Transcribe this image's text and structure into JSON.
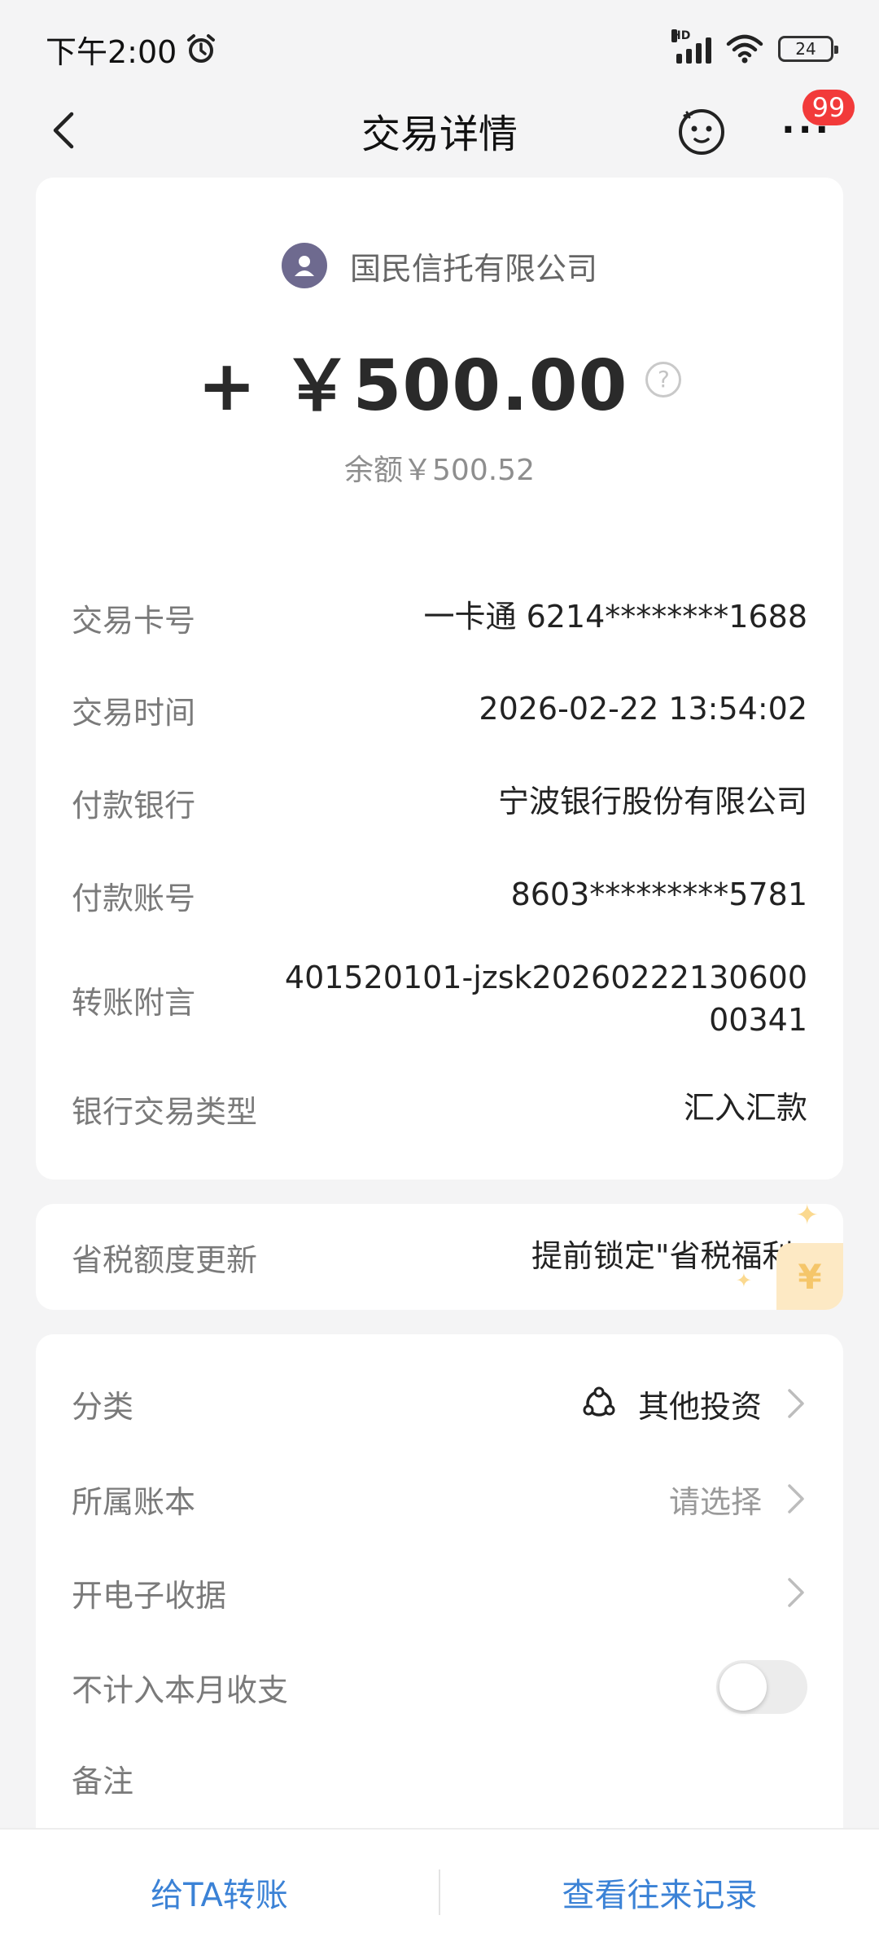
{
  "status_bar": {
    "time": "下午2:00",
    "network_label": "HD",
    "battery": "24"
  },
  "nav": {
    "title": "交易详情",
    "badge": "99"
  },
  "transaction": {
    "merchant": "国民信托有限公司",
    "amount": "+ ￥500.00",
    "balance": "余额￥500.52",
    "details": [
      {
        "label": "交易卡号",
        "value": "一卡通 6214********1688"
      },
      {
        "label": "交易时间",
        "value": "2026-02-22 13:54:02"
      },
      {
        "label": "付款银行",
        "value": "宁波银行股份有限公司"
      },
      {
        "label": "付款账号",
        "value": "8603*********5781"
      },
      {
        "label": "转账附言",
        "value_line1": "401520101-jzsk20260222130600",
        "value_line2": "00341"
      },
      {
        "label": "银行交易类型",
        "value": "汇入汇款"
      }
    ]
  },
  "tax": {
    "label": "省税额度更新",
    "value": "提前锁定\"省税福利\""
  },
  "settings": {
    "category": {
      "label": "分类",
      "value": "其他投资"
    },
    "ledger": {
      "label": "所属账本",
      "placeholder": "请选择"
    },
    "receipt": {
      "label": "开电子收据"
    },
    "exclude": {
      "label": "不计入本月收支",
      "enabled": false
    },
    "note": {
      "label": "备注"
    }
  },
  "bottom": {
    "transfer": "给TA转账",
    "history": "查看往来记录"
  },
  "colors": {
    "accent_blue": "#3b82d6",
    "badge_red": "#f23a3a",
    "background": "#f4f4f5"
  }
}
